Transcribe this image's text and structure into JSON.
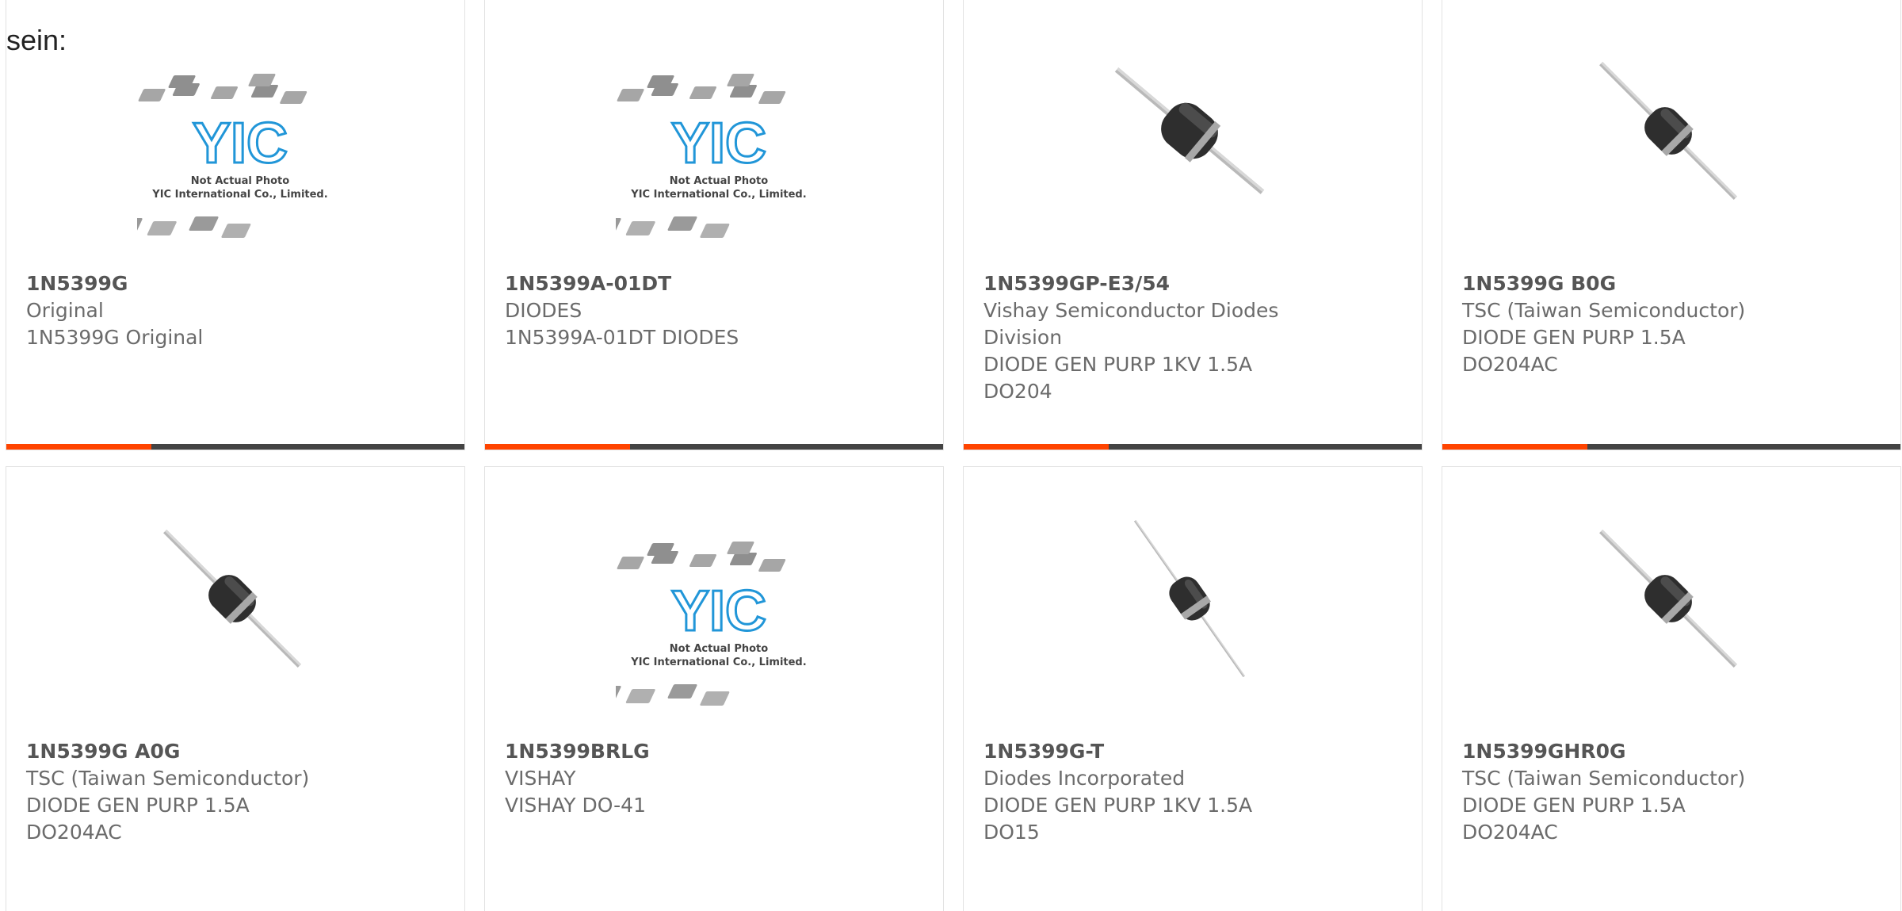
{
  "intro_text": "sein:",
  "colors": {
    "accent": "#ff4400",
    "bar": "#444444",
    "logo_blue": "#2196d8"
  },
  "products": [
    {
      "part": "1N5399G",
      "maker": "Original",
      "desc": "1N5399G Original",
      "image": "placeholder"
    },
    {
      "part": "1N5399A-01DT",
      "maker": "DIODES",
      "desc": "1N5399A-01DT DIODES",
      "image": "placeholder"
    },
    {
      "part": "1N5399GP-E3/54",
      "maker": "Vishay Semiconductor Diodes Division",
      "desc": "DIODE GEN PURP 1KV 1.5A DO204",
      "image": "diode-thick"
    },
    {
      "part": "1N5399G B0G",
      "maker": "TSC (Taiwan Semiconductor)",
      "desc": "DIODE GEN PURP 1.5A DO204AC",
      "image": "diode-down"
    },
    {
      "part": "1N5399G A0G",
      "maker": "TSC (Taiwan Semiconductor)",
      "desc": "DIODE GEN PURP 1.5A DO204AC",
      "image": "diode-down"
    },
    {
      "part": "1N5399BRLG",
      "maker": "VISHAY",
      "desc": "VISHAY DO-41",
      "image": "placeholder"
    },
    {
      "part": "1N5399G-T",
      "maker": "Diodes Incorporated",
      "desc": "DIODE GEN PURP 1KV 1.5A DO15",
      "image": "diode-thin"
    },
    {
      "part": "1N5399GHR0G",
      "maker": "TSC (Taiwan Semiconductor)",
      "desc": "DIODE GEN PURP 1.5A DO204AC",
      "image": "diode-down"
    }
  ],
  "placeholder": {
    "logo_text": "YIC",
    "line1": "Not Actual Photo",
    "line2": "YIC International Co., Limited."
  }
}
